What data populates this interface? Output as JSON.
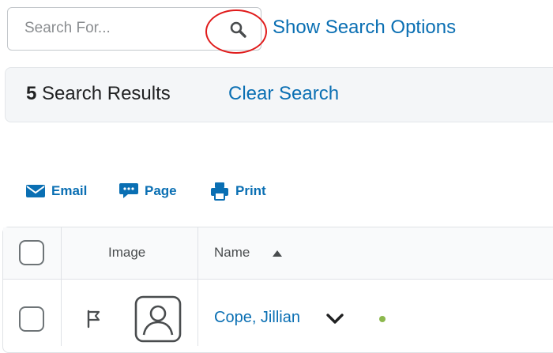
{
  "search": {
    "placeholder": "Search For...",
    "show_options_label": "Show Search Options"
  },
  "results": {
    "count": "5",
    "suffix": " Search Results",
    "clear_label": "Clear Search"
  },
  "actions": [
    {
      "label": "Email",
      "icon": "envelope-icon"
    },
    {
      "label": "Page",
      "icon": "chat-bubble-icon"
    },
    {
      "label": "Print",
      "icon": "printer-icon"
    }
  ],
  "table": {
    "headers": {
      "image": "Image",
      "name": "Name"
    },
    "sort_direction": "ascending",
    "rows": [
      {
        "name": "Cope, Jillian",
        "status_color": "#8cb84d",
        "icons": [
          "flag-icon",
          "profile-placeholder-icon",
          "chevron-down-icon"
        ]
      }
    ]
  },
  "colors": {
    "link": "#0a6fb3",
    "annotation": "#e01b1b"
  }
}
